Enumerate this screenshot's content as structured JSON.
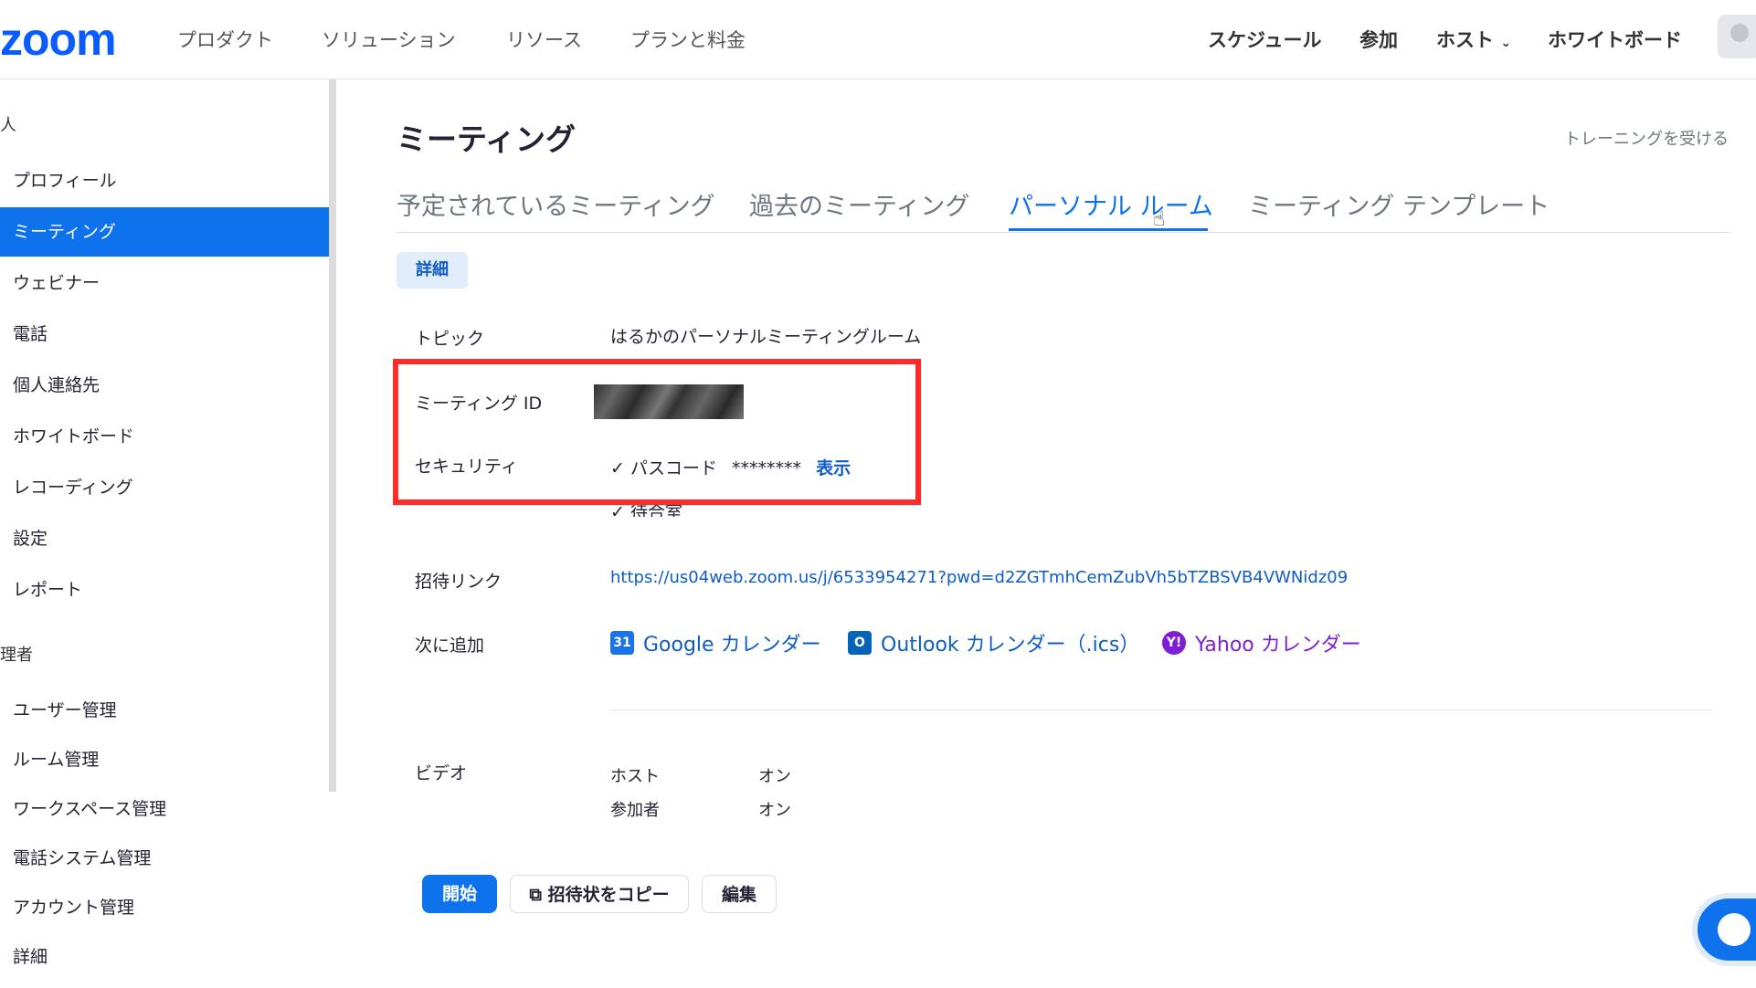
{
  "header": {
    "logo": "zoom",
    "nav": [
      "プロダクト",
      "ソリューション",
      "リソース",
      "プランと料金"
    ],
    "right_nav": [
      "スケジュール",
      "参加",
      "ホスト",
      "ホワイトボード"
    ]
  },
  "sidebar": {
    "section_personal": "人",
    "items_personal": [
      "プロフィール",
      "ミーティング",
      "ウェビナー",
      "電話",
      "個人連絡先",
      "ホワイトボード",
      "レコーディング",
      "設定",
      "レポート"
    ],
    "section_admin": "理者",
    "items_admin": [
      "ユーザー管理",
      "ルーム管理",
      "ワークスペース管理",
      "電話システム管理",
      "アカウント管理",
      "詳細"
    ]
  },
  "main": {
    "title": "ミーティング",
    "training_link": "トレーニングを受ける",
    "tabs": [
      "予定されているミーティング",
      "過去のミーティング",
      "パーソナル ルーム",
      "ミーティング テンプレート"
    ],
    "detail_pill": "詳細",
    "topic_label": "トピック",
    "topic_value": "はるかのパーソナルミーティングルーム",
    "meeting_id_label": "ミーティング ID",
    "security_label": "セキュリティ",
    "passcode_check": "✓ パスコード",
    "passcode_mask": "********",
    "show_link": "表示",
    "waiting_room": "✓ 待合室",
    "invite_label": "招待リンク",
    "invite_url": "https://us04web.zoom.us/j/6533954271?pwd=d2ZGTmhCemZubVh5bTZBSVB4VWNidz09",
    "add_to_label": "次に追加",
    "google_cal": "Google カレンダー",
    "outlook_cal": "Outlook カレンダー（.ics）",
    "yahoo_cal": "Yahoo カレンダー",
    "video_label": "ビデオ",
    "host_label": "ホスト",
    "host_value": "オン",
    "participant_label": "参加者",
    "participant_value": "オン",
    "start_button": "開始",
    "copy_button": "招待状をコピー",
    "edit_button": "編集"
  }
}
